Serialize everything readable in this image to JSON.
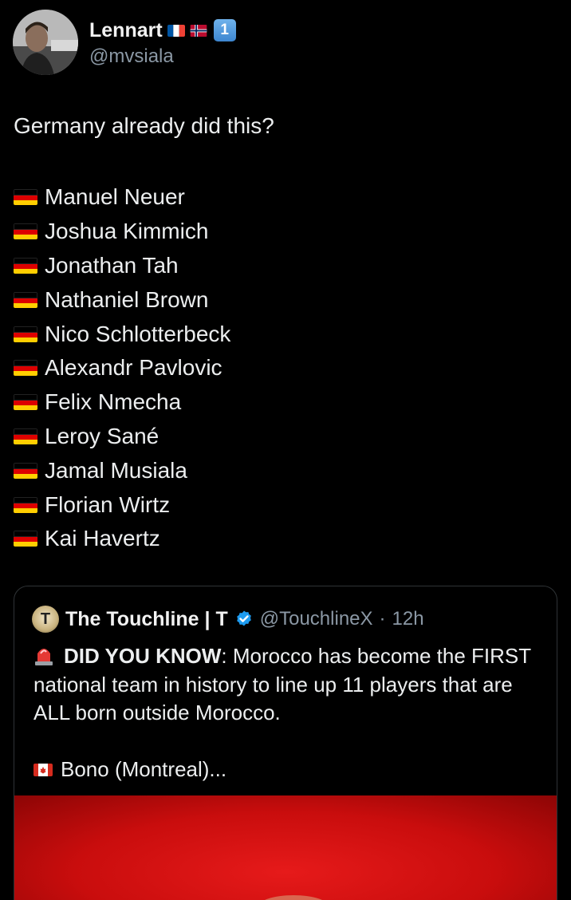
{
  "author": {
    "display_name": "Lennart",
    "handle": "@mvsiala",
    "badge": "1"
  },
  "tweet": {
    "text": "Germany already did this?",
    "players": [
      "Manuel Neuer",
      "Joshua Kimmich",
      "Jonathan Tah",
      "Nathaniel Brown",
      "Nico Schlotterbeck",
      "Alexandr Pavlovic",
      "Felix Nmecha",
      "Leroy Sané",
      "Jamal Musiala",
      "Florian Wirtz",
      "Kai Havertz"
    ]
  },
  "quote": {
    "display_name": "The Touchline | T",
    "avatar_letter": "T",
    "handle": "@TouchlineX",
    "separator": "·",
    "time": "12h",
    "headline": "DID YOU KNOW",
    "body": ": Morocco has become the FIRST national team in history to line up 11 players that are ALL born outside Morocco.",
    "bono": "Bono (Montreal)..."
  },
  "colors": {
    "background": "#000000",
    "text": "#e7e9ea",
    "secondary": "#8b98a5",
    "verified": "#1d9bf0",
    "media_red": "#c90d0d"
  }
}
